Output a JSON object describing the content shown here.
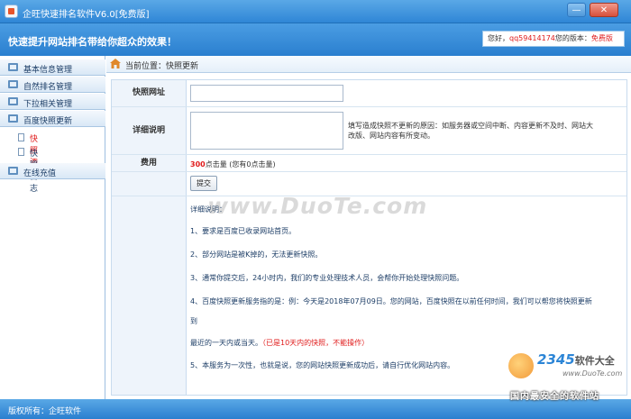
{
  "window": {
    "title": "企旺快速排名软件V6.0[免费版]",
    "minimize_glyph": "—",
    "close_glyph": "✕"
  },
  "banner": {
    "slogan": "快速提升网站排名带给你超众的效果！",
    "greeting_prefix": "您好，",
    "username": "qq59414174",
    "version_prefix": "您的版本：",
    "version_value": "免费版"
  },
  "sidebar": {
    "items": [
      {
        "label": "基本信息管理"
      },
      {
        "label": "自然排名管理"
      },
      {
        "label": "下拉相关管理"
      },
      {
        "label": "百度快照更新"
      },
      {
        "label": "在线充值"
      }
    ],
    "subitems": [
      {
        "label": "快照添加",
        "active": true
      },
      {
        "label": "快照日志",
        "active": false
      }
    ]
  },
  "breadcrumb": {
    "prefix": "当前位置：",
    "current": "快照更新"
  },
  "form": {
    "url_label": "快照网址",
    "url_value": "",
    "desc_label": "详细说明",
    "desc_value": "",
    "hint": "填写造成快照不更新的原因：如服务器或空间中断、内容更新不及时、网站大改版、网站内容有所变动。",
    "fee_label": "费用",
    "fee_amount": "300",
    "fee_unit": "点击量",
    "fee_balance": "(您有0点击量)",
    "submit_label": "提交"
  },
  "notes": {
    "title": "详细说明：",
    "items": [
      "1、要求是百度已收录网站首页。",
      "2、部分网站是被K掉的，无法更新快照。",
      "3、通常你提交后，24小时内，我们的专业处理技术人员，会帮你开始处理快照问题。",
      "4、百度快照更新服务指的是：例：今天是2018年07月09日。您的网站，百度快照在以前任何时间，我们可以帮您将快照更新",
      "到",
      "最近的一天内或当天。",
      "5、本服务为一次性，也就是说，您的网站快照更新成功后，请自行优化网站内容。"
    ],
    "warning": "（已是10天内的快照，不能操作）"
  },
  "watermark": "www.DuoTe.com",
  "footer": {
    "copyright": "版权所有：企旺软件"
  },
  "logo": {
    "brand_number": "2345",
    "brand_text": "软件大全",
    "site": "www.DuoTe.com",
    "slogan": "国内最安全的软件站"
  },
  "colors": {
    "accent_blue": "#2f86d6",
    "warning_red": "#e01b1b"
  }
}
